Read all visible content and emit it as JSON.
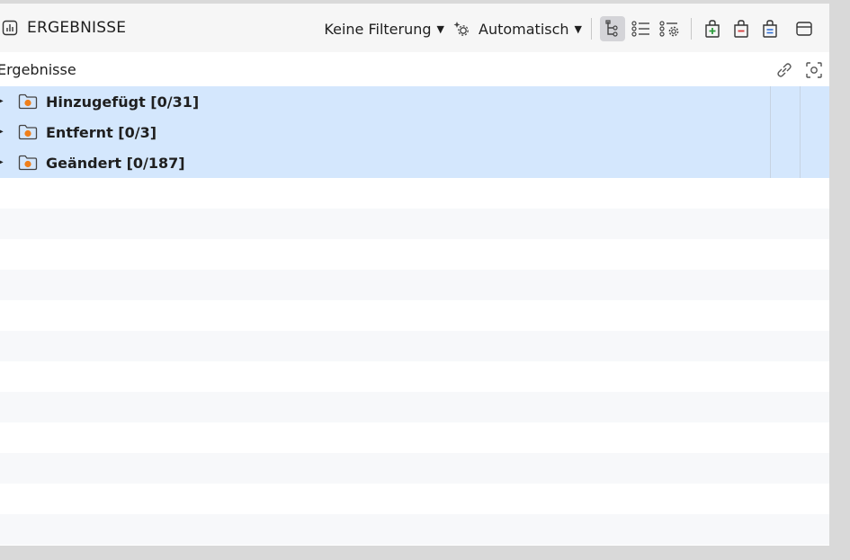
{
  "panel": {
    "title": "ERGEBNISSE",
    "title_icon": "bar-chart-icon"
  },
  "toolbar": {
    "filter_label": "Keine Filterung",
    "mode_label": "Automatisch",
    "mode_icon": "settings-sparkle-icon",
    "buttons": [
      {
        "name": "tree-view-button",
        "icon": "tree-icon",
        "active": true
      },
      {
        "name": "list-view-button",
        "icon": "list-icon",
        "active": false
      },
      {
        "name": "list-settings-button",
        "icon": "list-gear-icon",
        "active": false
      },
      {
        "name": "bag-add-button",
        "icon": "bag-plus-icon",
        "color": "#2e9e3e"
      },
      {
        "name": "bag-remove-button",
        "icon": "bag-minus-icon",
        "color": "#d43b3b"
      },
      {
        "name": "bag-changed-button",
        "icon": "bag-equal-icon",
        "color": "#2f6fd6"
      },
      {
        "name": "panel-layout-button",
        "icon": "panel-icon"
      }
    ]
  },
  "columns": {
    "results_label": "Ergebnisse",
    "link_icon": "link-icon",
    "focus_icon": "focus-icon"
  },
  "rows": [
    {
      "label": "Hinzugefügt [0/31]",
      "expanded": false
    },
    {
      "label": "Entfernt [0/3]",
      "expanded": false
    },
    {
      "label": "Geändert [0/187]",
      "expanded": false
    }
  ],
  "colors": {
    "selection": "#d4e7fd",
    "folder_dot": "#f07f1a",
    "header_bg": "#f6f6f6"
  }
}
